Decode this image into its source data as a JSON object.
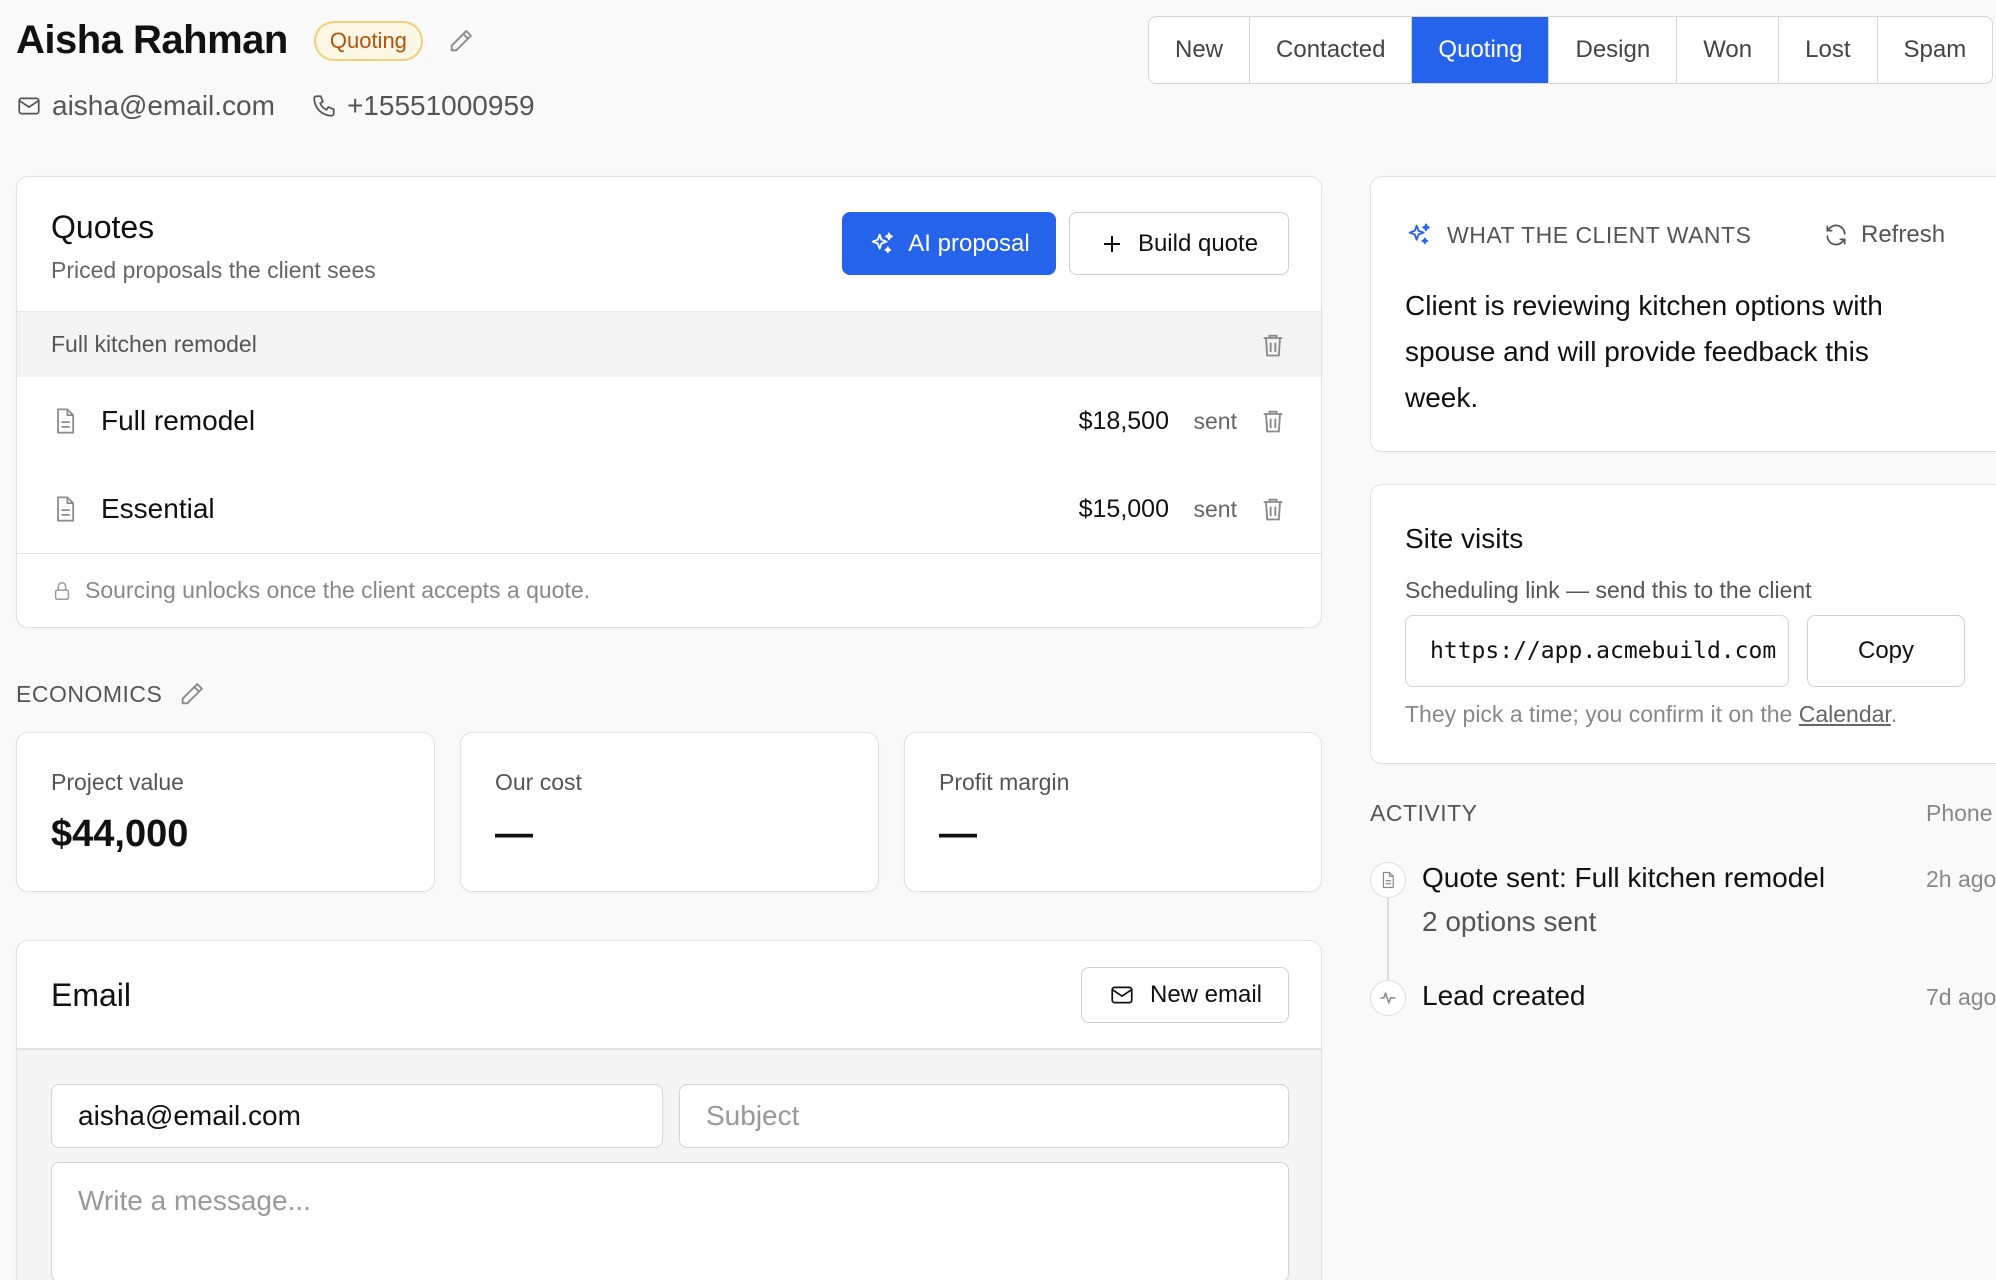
{
  "lead": {
    "name": "Aisha Rahman",
    "stage_badge": "Quoting",
    "email": "aisha@email.com",
    "phone": "+15551000959"
  },
  "stages": [
    {
      "label": "New",
      "active": false
    },
    {
      "label": "Contacted",
      "active": false
    },
    {
      "label": "Quoting",
      "active": true
    },
    {
      "label": "Design",
      "active": false
    },
    {
      "label": "Won",
      "active": false
    },
    {
      "label": "Lost",
      "active": false
    },
    {
      "label": "Spam",
      "active": false
    }
  ],
  "quotes": {
    "title": "Quotes",
    "subtitle": "Priced proposals the client sees",
    "ai_button": "AI proposal",
    "build_button": "Build quote",
    "group": "Full kitchen remodel",
    "items": [
      {
        "name": "Full remodel",
        "amount": "$18,500",
        "status": "sent"
      },
      {
        "name": "Essential",
        "amount": "$15,000",
        "status": "sent"
      }
    ],
    "footer": "Sourcing unlocks once the client accepts a quote."
  },
  "economics": {
    "label": "ECONOMICS",
    "metrics": [
      {
        "label": "Project value",
        "value": "$44,000"
      },
      {
        "label": "Our cost",
        "value": "—"
      },
      {
        "label": "Profit margin",
        "value": "—"
      }
    ]
  },
  "email": {
    "title": "Email",
    "new_button": "New email",
    "to_value": "aisha@email.com",
    "subject_placeholder": "Subject",
    "message_placeholder": "Write a message..."
  },
  "client_wants": {
    "heading": "WHAT THE CLIENT WANTS",
    "refresh": "Refresh",
    "text": "Client is reviewing kitchen options with spouse and will provide feedback this week."
  },
  "site_visits": {
    "title": "Site visits",
    "subtitle": "Scheduling link — send this to the client",
    "link": "https://app.acmebuild.com",
    "copy_button": "Copy",
    "hint_prefix": "They pick a time; you confirm it on the ",
    "hint_link": "Calendar",
    "hint_suffix": "."
  },
  "activity": {
    "label": "ACTIVITY",
    "filter": "Phone",
    "items": [
      {
        "title": "Quote sent: Full kitchen remodel",
        "detail": "2 options sent",
        "time": "2h ago"
      },
      {
        "title": "Lead created",
        "detail": "",
        "time": "7d ago"
      }
    ]
  },
  "colors": {
    "accent": "#2563eb",
    "badge_bg": "#fff7e6",
    "badge_text": "#b45309"
  }
}
